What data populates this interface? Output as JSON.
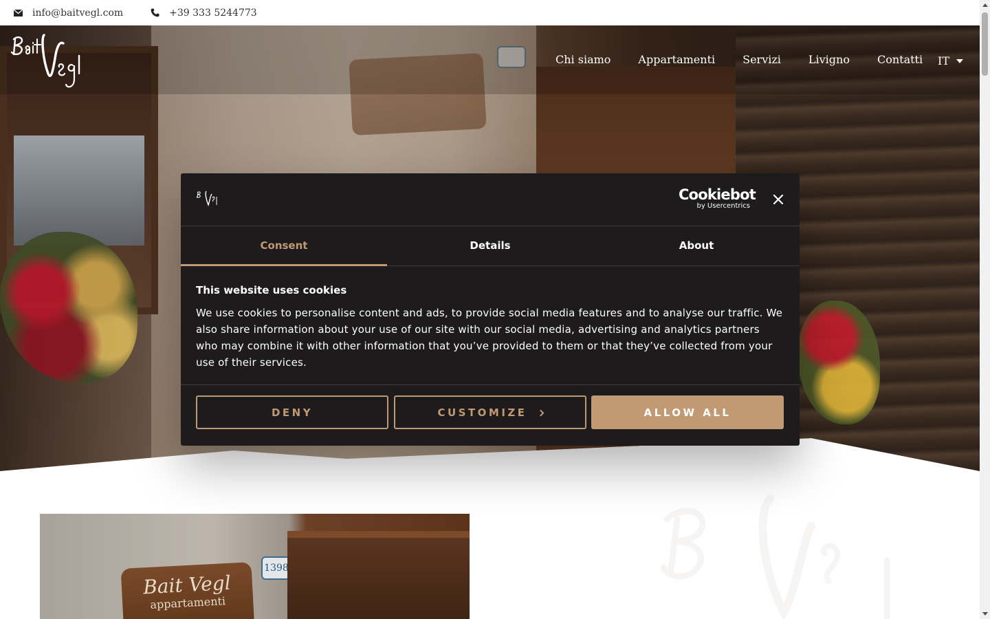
{
  "topbar": {
    "email": "info@baitvegl.com",
    "phone": "+39 333 5244773",
    "email_icon": "envelope-icon",
    "phone_icon": "phone-icon"
  },
  "header": {
    "logo_text": "Bait Vegl",
    "nav": [
      "Chi siamo",
      "Appartamenti",
      "Servizi",
      "Livigno",
      "Contatti"
    ],
    "language": "IT"
  },
  "hero": {
    "house_number": "1398",
    "sign_title": "Bait Vegl",
    "sign_subtitle": "appartamenti"
  },
  "cookie": {
    "brand": "Cookiebot",
    "brand_sub": "by Usercentrics",
    "tabs": [
      "Consent",
      "Details",
      "About"
    ],
    "active_tab": "Consent",
    "title": "This website uses cookies",
    "text": "We use cookies to personalise content and ads, to provide social media features and to analyse our traffic. We also share information about your use of our site with our social media, advertising and analytics partners who may combine it with other information that you’ve provided to them or that they’ve collected from your use of their services.",
    "buttons": {
      "deny": "DENY",
      "customize": "CUSTOMIZE",
      "allow": "ALLOW ALL"
    },
    "accent_color": "#c19a74",
    "bg_color": "#1d1b1b"
  }
}
